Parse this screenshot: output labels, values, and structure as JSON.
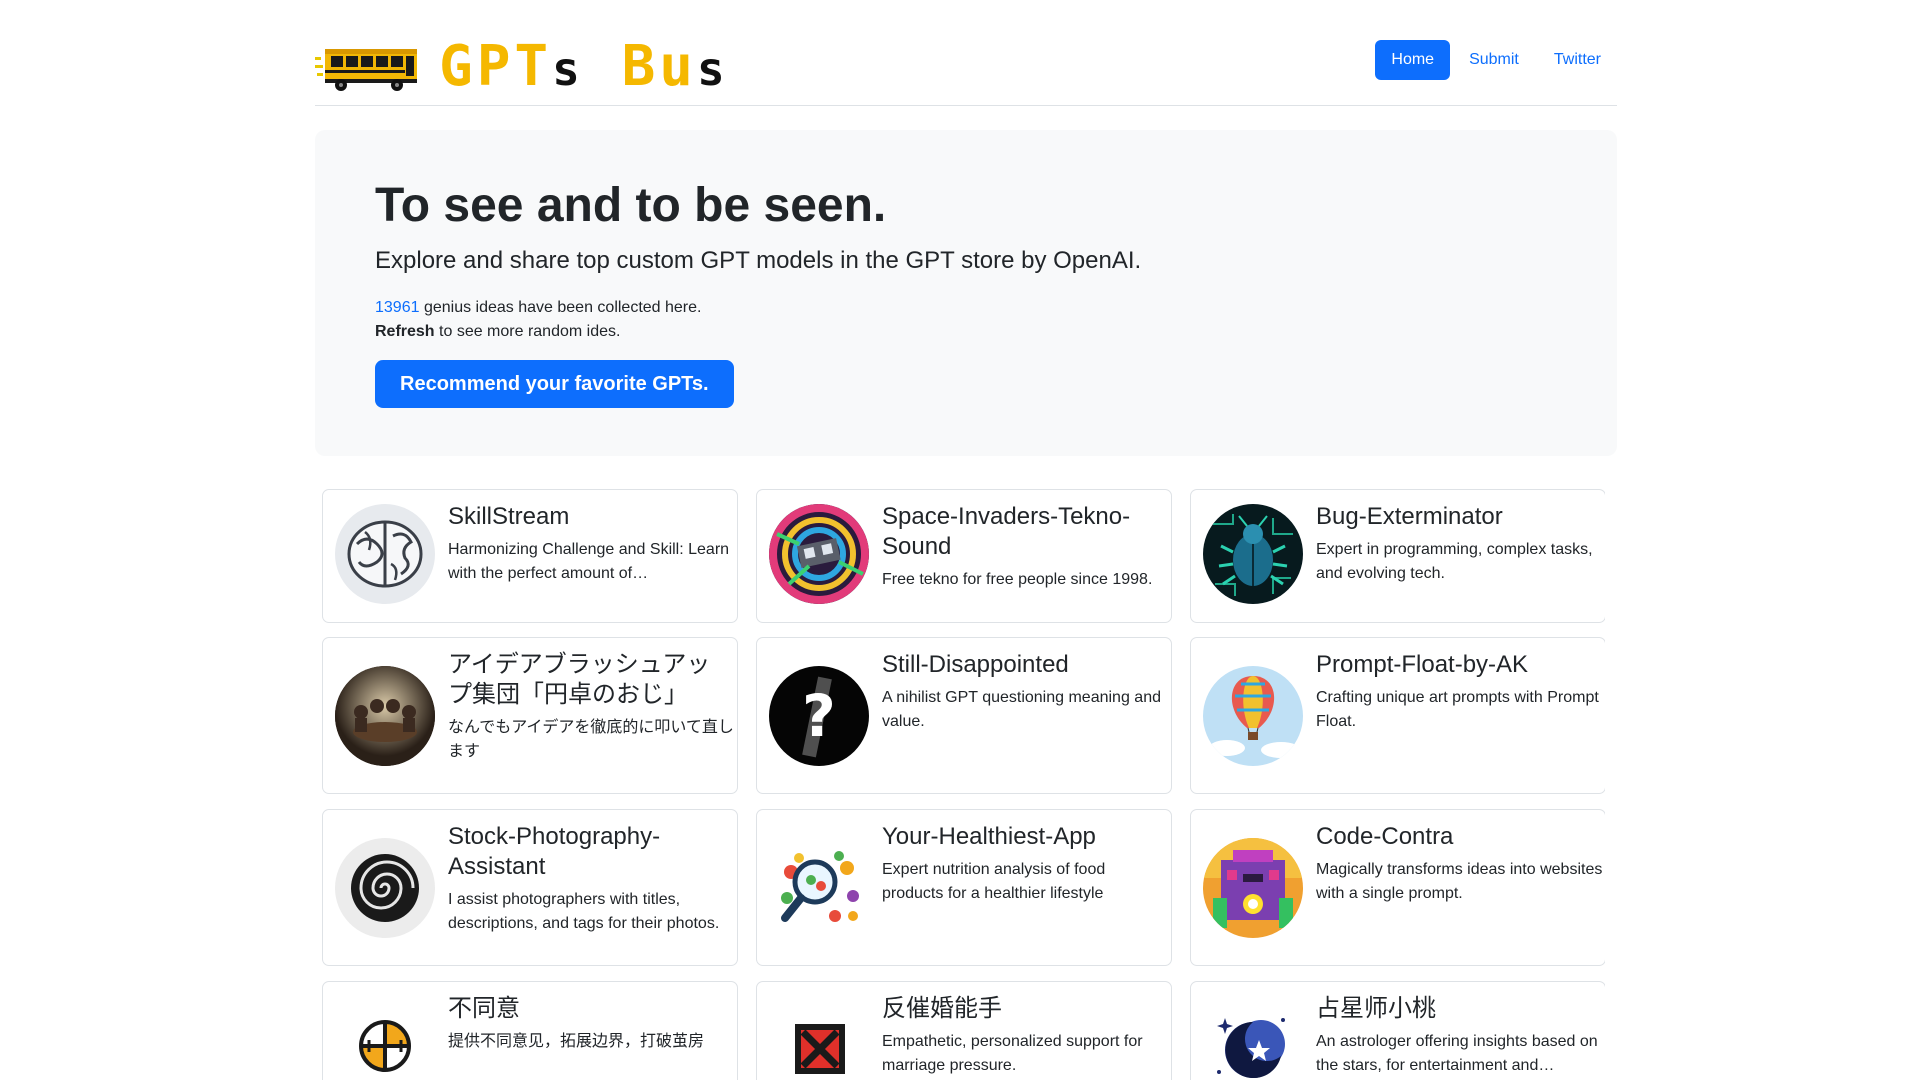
{
  "header": {
    "logo_text_a": "GPT",
    "logo_text_b": "s",
    "logo_text_c": "Bu",
    "logo_text_d": "s",
    "nav": [
      {
        "label": "Home",
        "active": true
      },
      {
        "label": "Submit",
        "active": false
      },
      {
        "label": "Twitter",
        "active": false
      }
    ]
  },
  "hero": {
    "title": "To see and to be seen.",
    "lead": "Explore and share top custom GPT models in the GPT store by OpenAI.",
    "count": "13961",
    "count_suffix": " genius ideas have been collected here.",
    "refresh_bold": "Refresh",
    "refresh_suffix": " to see more random ides.",
    "cta_label": "Recommend your favorite GPTs."
  },
  "cards": [
    {
      "title": "SkillStream",
      "desc": "Harmonizing Challenge and Skill: Learn with the perfect amount of…",
      "icon": "brain-icon"
    },
    {
      "title": "Space-Invaders-Tekno-Sound",
      "desc": "Free tekno for free people since 1998.",
      "icon": "tekno-art-icon"
    },
    {
      "title": "Bug-Exterminator",
      "desc": "Expert in programming, complex tasks, and evolving tech.",
      "icon": "beetle-icon"
    },
    {
      "title": "アイデアブラッシュアップ集団「円卓のおじ」",
      "desc": "なんでもアイデアを徹底的に叩いて直します",
      "icon": "round-table-icon"
    },
    {
      "title": "Still-Disappointed",
      "desc": "A nihilist GPT questioning meaning and value.",
      "icon": "question-mark-icon"
    },
    {
      "title": "Prompt-Float-by-AK",
      "desc": "Crafting unique art prompts with Prompt Float.",
      "icon": "hot-air-balloon-icon"
    },
    {
      "title": "Stock-Photography-Assistant",
      "desc": "I assist photographers with titles, descriptions, and tags for their photos.",
      "icon": "spiral-icon"
    },
    {
      "title": "Your-Healthiest-App",
      "desc": "Expert nutrition analysis of food products for a healthier lifestyle",
      "icon": "magnifier-food-icon"
    },
    {
      "title": "Code-Contra",
      "desc": "Magically transforms ideas into websites with a single prompt.",
      "icon": "pixel-temple-icon"
    },
    {
      "title": "不同意",
      "desc": "提供不同意见，拓展边界，打破茧房",
      "icon": "crosshair-circle-icon"
    },
    {
      "title": "反催婚能手",
      "desc": "Empathetic, personalized support for marriage pressure.",
      "icon": "x-box-icon"
    },
    {
      "title": "占星师小桃",
      "desc": "An astrologer offering insights based on the stars, for entertainment and…",
      "icon": "moon-stars-icon"
    }
  ],
  "colors": {
    "primary": "#0d6efd",
    "logo_yellow": "#f5b800",
    "hero_bg": "#f8f9fa",
    "border": "#dee2e6"
  }
}
